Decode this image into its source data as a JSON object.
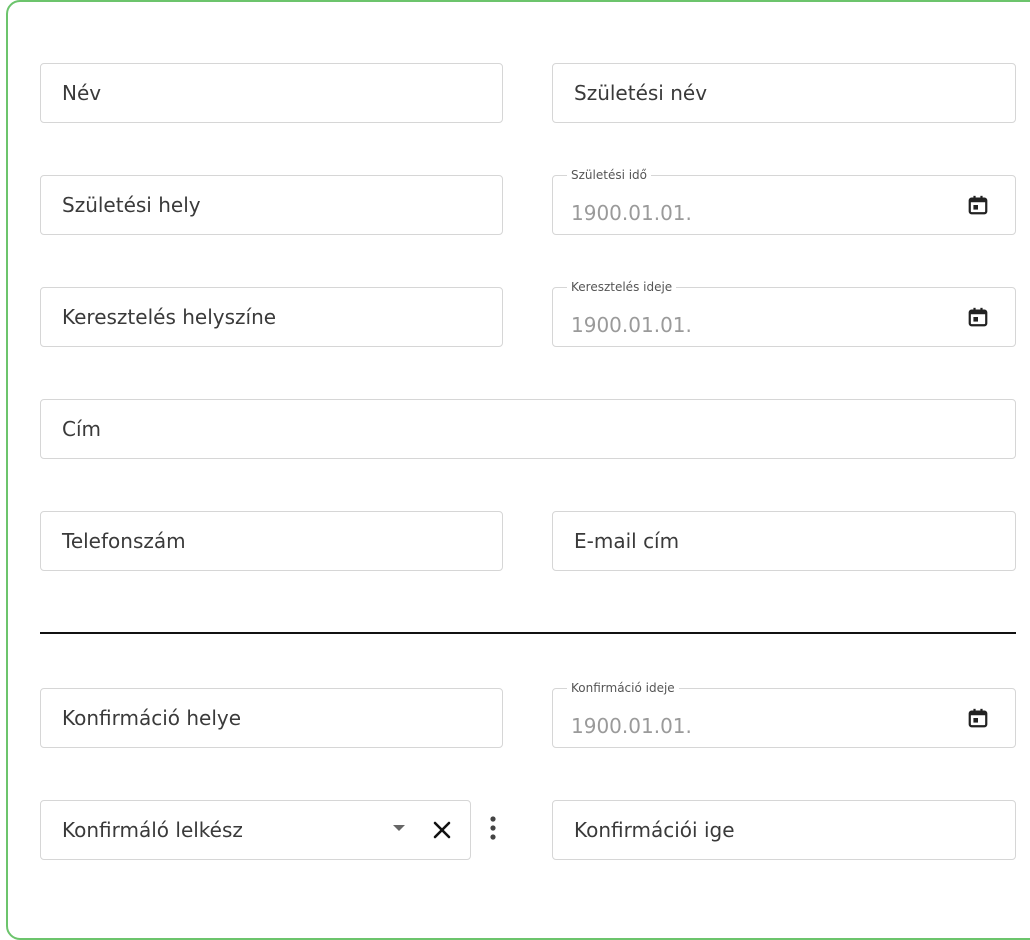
{
  "form": {
    "nev": {
      "placeholder": "Név"
    },
    "szuletesi_nev": {
      "placeholder": "Születési név"
    },
    "szuletesi_hely": {
      "placeholder": "Születési hely"
    },
    "szuletesi_ido": {
      "label": "Születési idő",
      "value": "1900.01.01."
    },
    "kereszteles_helyszine": {
      "placeholder": "Keresztelés helyszíne"
    },
    "kereszteles_ideje": {
      "label": "Keresztelés ideje",
      "value": "1900.01.01."
    },
    "cim": {
      "placeholder": "Cím"
    },
    "telefonszam": {
      "placeholder": "Telefonszám"
    },
    "email": {
      "placeholder": "E-mail cím"
    },
    "konfirmacio_helye": {
      "placeholder": "Konfirmáció helye"
    },
    "konfirmacio_ideje": {
      "label": "Konfirmáció ideje",
      "value": "1900.01.01."
    },
    "konfirmalo_lelkesz": {
      "placeholder": "Konfirmáló lelkész"
    },
    "konfirmacioi_ige": {
      "placeholder": "Konfirmációi ige"
    }
  },
  "icons": {
    "calendar": "calendar-icon",
    "dropdown": "chevron-down-icon",
    "clear": "close-icon",
    "more": "more-vertical-icon"
  },
  "colors": {
    "card_border": "#6cc46c",
    "field_border": "#d6d6d6",
    "divider": "#111111"
  }
}
